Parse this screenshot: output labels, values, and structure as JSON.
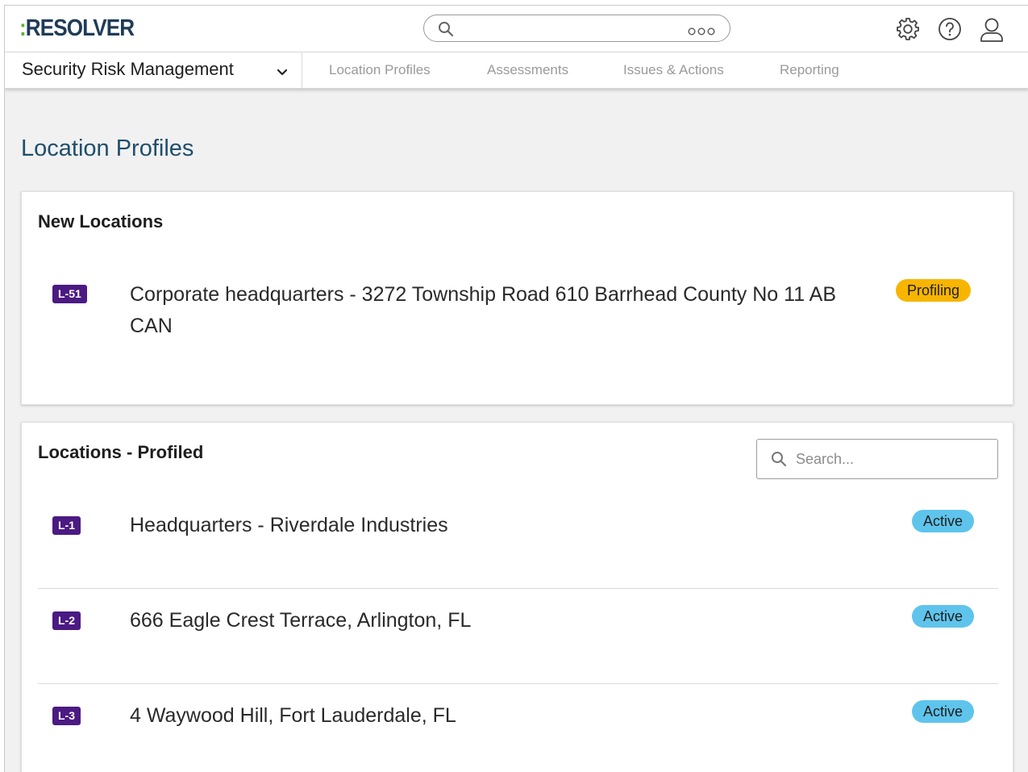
{
  "brand": {
    "colon": ":",
    "name": "RESOLVER",
    "colors": {
      "brand_navy": "#1f3c57",
      "brand_green": "#5bb431"
    }
  },
  "header": {
    "search_icon": "search-icon",
    "more_icon": "more-options-icon",
    "icons": [
      "gear-icon",
      "help-icon",
      "user-icon"
    ]
  },
  "nav": {
    "app_name": "Security Risk Management",
    "tabs": [
      {
        "label": "Location Profiles"
      },
      {
        "label": "Assessments"
      },
      {
        "label": "Issues & Actions"
      },
      {
        "label": "Reporting"
      }
    ]
  },
  "page": {
    "title": "Location Profiles"
  },
  "new_locations": {
    "title": "New Locations",
    "items": [
      {
        "id": "L-51",
        "name": "Corporate headquarters - 3272 Township Road 610 Barrhead County No 11 AB CAN",
        "status": "Profiling"
      }
    ]
  },
  "profiled": {
    "title": "Locations - Profiled",
    "search_placeholder": "Search...",
    "items": [
      {
        "id": "L-1",
        "name": "Headquarters - Riverdale Industries",
        "status": "Active"
      },
      {
        "id": "L-2",
        "name": "666 Eagle Crest Terrace, Arlington, FL",
        "status": "Active"
      },
      {
        "id": "L-3",
        "name": "4 Waywood Hill, Fort Lauderdale, FL",
        "status": "Active"
      }
    ]
  },
  "colors": {
    "badge_purple": "#4b1a82",
    "status_profiling": "#f7b500",
    "status_active": "#5fc4ec",
    "title_blue": "#1f4e6d"
  }
}
